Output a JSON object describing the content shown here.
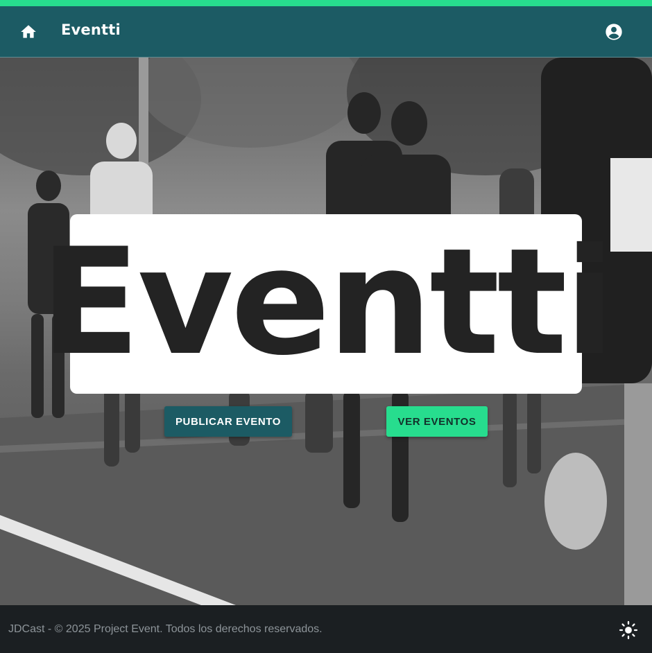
{
  "app": {
    "brand_title": "Eventti",
    "accent_color": "#27dd8e",
    "primary_color": "#1c5b64"
  },
  "header": {
    "home_icon": "home-icon",
    "account_icon": "account-circle-icon"
  },
  "hero": {
    "logo_text": "Eventti",
    "publish_button_label": "PUBLICAR EVENTO",
    "view_events_button_label": "VER EVENTOS"
  },
  "footer": {
    "copyright": "JDCast - © 2025 Project Event. Todos los derechos reservados.",
    "theme_icon": "sun-icon"
  }
}
